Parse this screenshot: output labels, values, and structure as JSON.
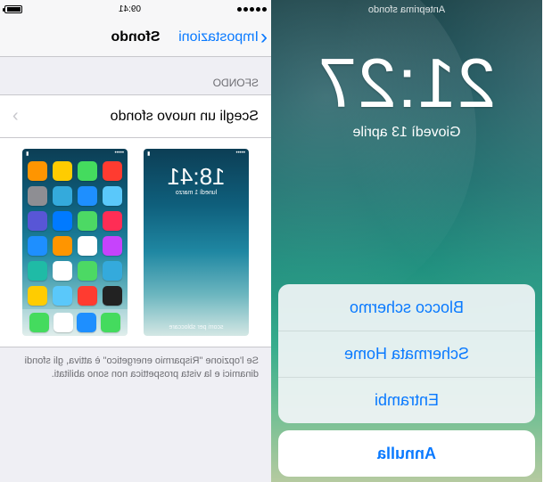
{
  "left": {
    "preview_label": "Anteprima sfondo",
    "clock": "21:27",
    "date": "Giovedì 13 aprile",
    "actions": {
      "lock": "Blocco schermo",
      "home": "Schermata Home",
      "both": "Entrambi",
      "cancel": "Annulla"
    }
  },
  "right": {
    "status": {
      "time": "09:41"
    },
    "nav": {
      "back": "Impostazioni",
      "title": "Sfondo"
    },
    "section_header": "SFONDO",
    "choose_row": "Scegli un nuovo sfondo",
    "preview_lock": {
      "time": "18:41",
      "date": "lunedì 1 marzo",
      "slide": "scorri per sbloccare"
    },
    "footer": "Se l'opzione \"Risparmio energetico\" è attiva, gli sfondi dinamici e la vista prospettica non sono abilitati.",
    "home_icons": [
      "#ff3b30",
      "#44db5e",
      "#ffcc00",
      "#ff9500",
      "#5ac8fa",
      "#1e8fff",
      "#34aadc",
      "#8e8e93",
      "#ff2d55",
      "#4cd964",
      "#007aff",
      "#5856d6",
      "#c643fc",
      "#ffffff",
      "#ff9500",
      "#1e8fff",
      "#34aadc",
      "#4cd964",
      "#ffffff",
      "#1fbba6",
      "#222222",
      "#ff3b30",
      "#5ac8fa",
      "#ffcc00"
    ],
    "dock_icons": [
      "#44db5e",
      "#1e8fff",
      "#ffffff",
      "#44db5e"
    ]
  }
}
